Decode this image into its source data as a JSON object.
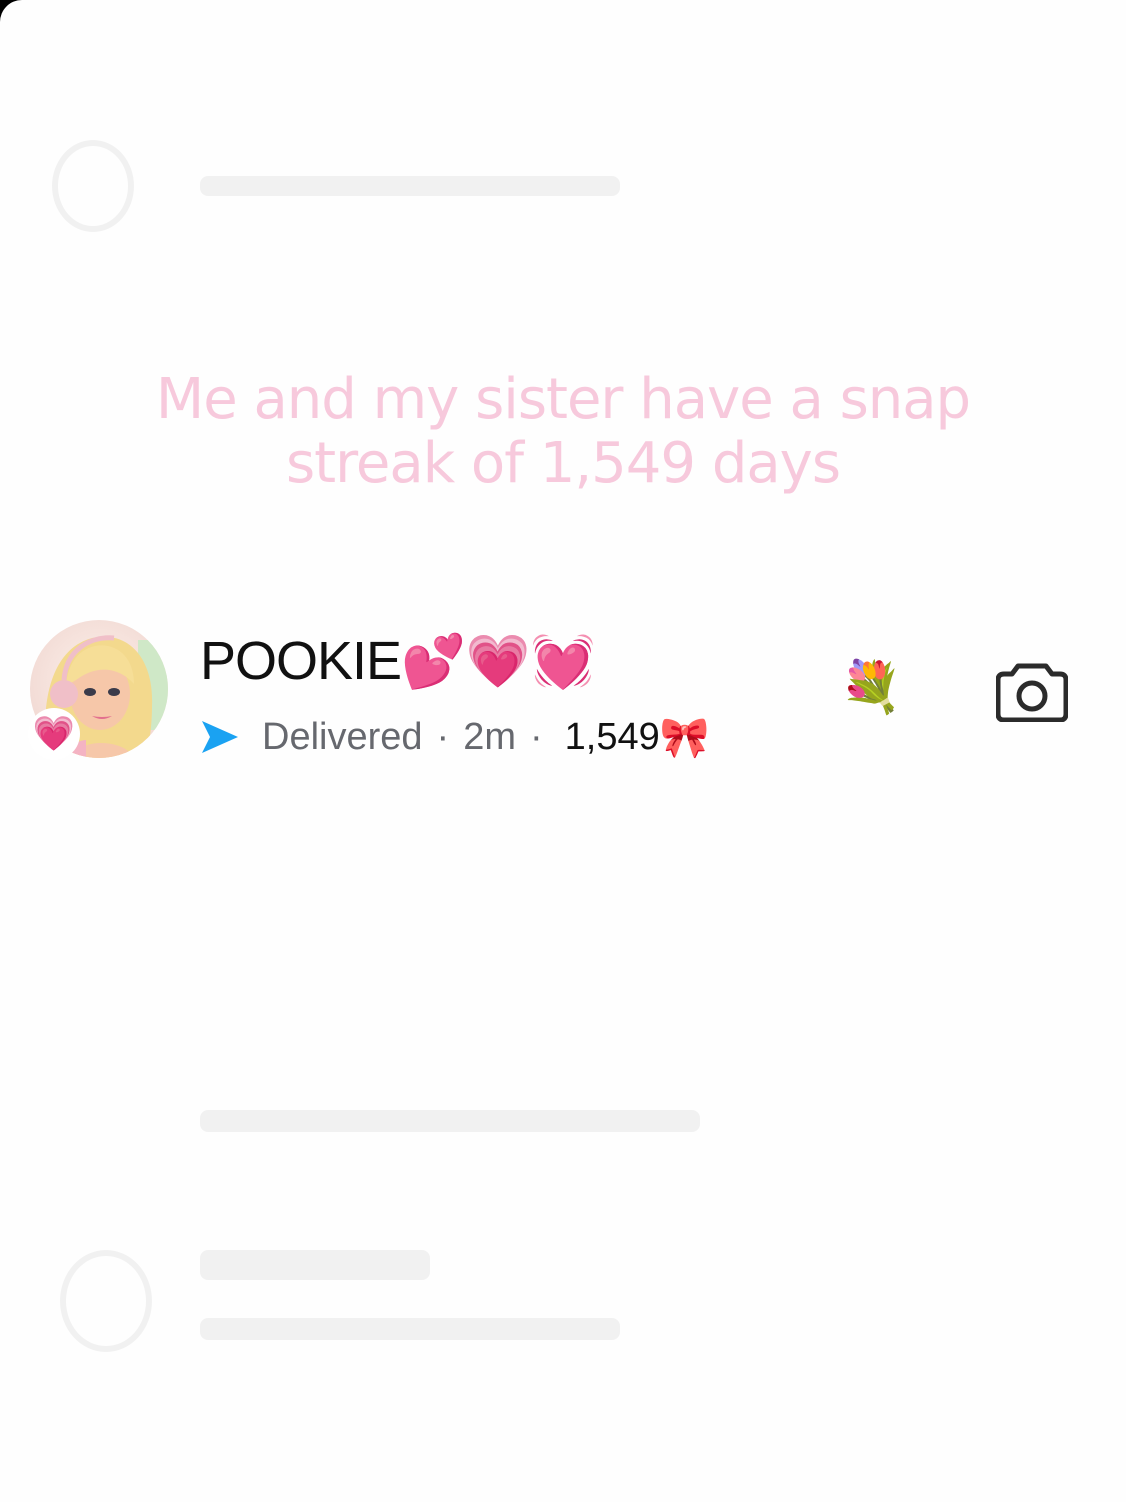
{
  "caption": "Me and my sister have a snap streak of 1,549 days",
  "chat": {
    "name": "POOKIE",
    "name_emojis": "💕💗💓",
    "avatar_badge": "💗",
    "status": "Delivered",
    "time": "2m",
    "streak_count": "1,549",
    "streak_emoji": "🎀",
    "friend_emoji": "💐"
  },
  "colors": {
    "caption": "#f7c9dc",
    "sent_arrow": "#1aa2f2",
    "status_text": "#66686e"
  }
}
